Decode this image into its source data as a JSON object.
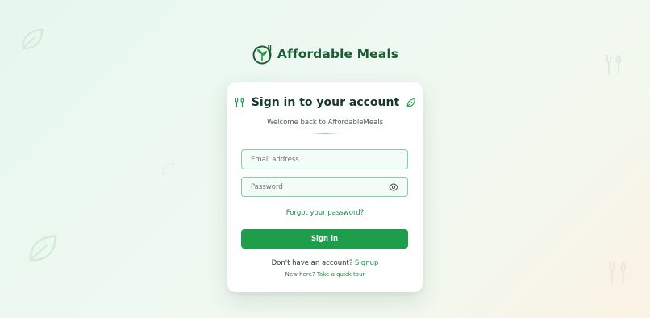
{
  "brand": {
    "name": "Affordable Meals",
    "logo_icon": "plate-fork-leaf-icon",
    "color": "#1a5c34"
  },
  "card": {
    "title": "Sign in to your account",
    "subtitle": "Welcome back to AffordableMeals",
    "title_left_icon": "utensils-icon",
    "title_right_icon": "leaf-icon"
  },
  "form": {
    "email_placeholder": "Email address",
    "email_value": "",
    "password_placeholder": "Password",
    "password_value": "",
    "password_toggle_icon": "eye-icon",
    "forgot_label": "Forgot your password?",
    "signin_label": "Sign in"
  },
  "footer": {
    "no_account_text": "Don't have an account?",
    "signup_label": "Signup",
    "new_here_text": "New here?",
    "tour_label": "Take a quick tour"
  },
  "colors": {
    "accent": "#1e9d4b",
    "link": "#1e8c45",
    "field_border": "#7fd3a1"
  }
}
